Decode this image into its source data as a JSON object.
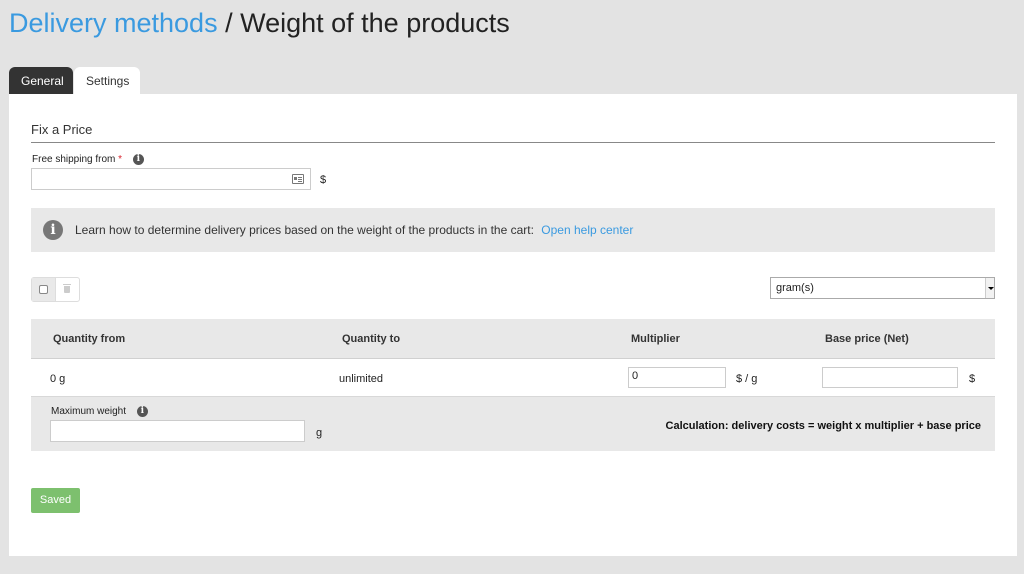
{
  "header": {
    "breadcrumb_link": "Delivery methods",
    "separator": " / ",
    "title": "Weight of the products"
  },
  "tabs": [
    {
      "label": "General",
      "active": false
    },
    {
      "label": "Settings",
      "active": true
    }
  ],
  "section": {
    "title": "Fix a Price"
  },
  "free_shipping": {
    "label": "Free shipping from",
    "required_mark": "*",
    "value": "",
    "unit": "$"
  },
  "help": {
    "text": "Learn how to determine delivery prices based on the weight of the products in the cart:",
    "link": "Open help center"
  },
  "unit_select": {
    "selected": "gram(s)"
  },
  "table": {
    "headers": [
      "Quantity from",
      "Quantity to",
      "Multiplier",
      "Base price (Net)"
    ],
    "row": {
      "quantity_from": "0 g",
      "quantity_to": "unlimited",
      "multiplier": "0",
      "multiplier_unit": "$ / g",
      "base_price": "",
      "base_price_unit": "$"
    }
  },
  "max_weight": {
    "label": "Maximum weight",
    "value": "",
    "unit": "g"
  },
  "calculation": "Calculation: delivery costs = weight x multiplier + base price",
  "save_button": "Saved",
  "colors": {
    "link": "#3a9ae0",
    "save_button": "#7dc06e",
    "active_tab": "#333333"
  }
}
